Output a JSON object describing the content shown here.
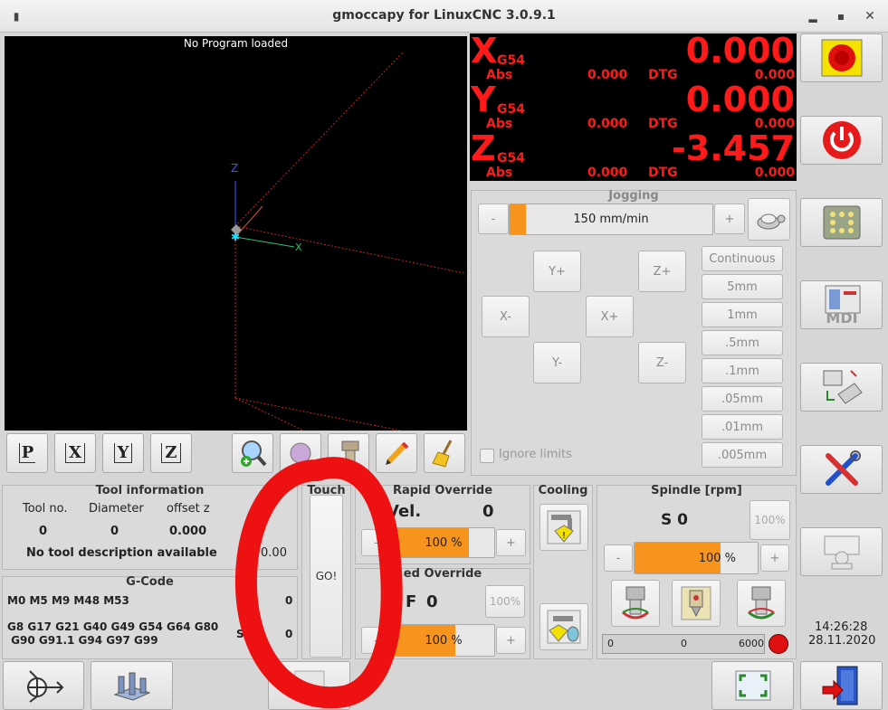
{
  "window": {
    "title": "gmoccapy for LinuxCNC  3.0.9.1"
  },
  "preview": {
    "message": "No Program loaded",
    "axis_x": "X",
    "axis_z": "Z"
  },
  "dro": {
    "x": {
      "axis": "X",
      "coord": "G54",
      "value": "0.000",
      "abs_label": "Abs",
      "abs": "0.000",
      "dtg_label": "DTG",
      "dtg": "0.000"
    },
    "y": {
      "axis": "Y",
      "coord": "G54",
      "value": "0.000",
      "abs_label": "Abs",
      "abs": "0.000",
      "dtg_label": "DTG",
      "dtg": "0.000"
    },
    "z": {
      "axis": "Z",
      "coord": "G54",
      "value": "-3.457",
      "abs_label": "Abs",
      "abs": "0.000",
      "dtg_label": "DTG",
      "dtg": "0.000"
    }
  },
  "jogging": {
    "title": "Jogging",
    "minus": "-",
    "plus": "+",
    "speed": "150 mm/min",
    "speed_fraction": 0.08,
    "buttons": {
      "yplus": "Y+",
      "zplus": "Z+",
      "xminus": "X-",
      "xplus": "X+",
      "yminus": "Y-",
      "zminus": "Z-"
    },
    "increments": [
      "Continuous",
      "5mm",
      "1mm",
      ".5mm",
      ".1mm",
      ".05mm",
      ".01mm",
      ".005mm"
    ],
    "ignore_limits": "Ignore limits"
  },
  "view_buttons": {
    "p": "P",
    "x": "X",
    "y": "Y",
    "z": "Z"
  },
  "tool": {
    "title": "Tool information",
    "headers": [
      "Tool no.",
      "Diameter",
      "offset z"
    ],
    "values": [
      "0",
      "0",
      "0.000"
    ],
    "description": "No tool description available",
    "extra": "= 0.00"
  },
  "gcode": {
    "title": "G-Code",
    "mcodes": "M0 M5 M9 M48 M53",
    "gcodes_line1": "G8 G17 G21 G40 G49 G54 G64 G80",
    "gcodes_line2": " G90 G91.1 G94 G97 G99",
    "val1": "0",
    "val2": "0",
    "s_label": "S"
  },
  "touch": {
    "title": "Touch",
    "go": "GO!"
  },
  "rapid": {
    "title": "Rapid Override",
    "vel_label": "Vel.",
    "vel_value": "0",
    "minus": "-",
    "plus": "+",
    "value": "100 %",
    "fraction": 0.75
  },
  "feed": {
    "title": "ed Override",
    "f_label": "F",
    "f_value": "0",
    "reset": "100%",
    "minus": "-",
    "plus": "+",
    "value": "100 %",
    "fraction": 0.62
  },
  "cooling": {
    "title": "Cooling"
  },
  "spindle": {
    "title": "Spindle [rpm]",
    "s_label": "S 0",
    "reset": "100%",
    "minus": "-",
    "plus": "+",
    "value": "100 %",
    "fraction": 0.7,
    "bar_min": "0",
    "bar_mid": "0",
    "bar_max": "6000"
  },
  "clock": {
    "time": "14:26:28",
    "date": "28.11.2020"
  },
  "colors": {
    "accent": "#f7941d",
    "dro_red": "#ff1a1a",
    "annotation": "#ee1111"
  }
}
